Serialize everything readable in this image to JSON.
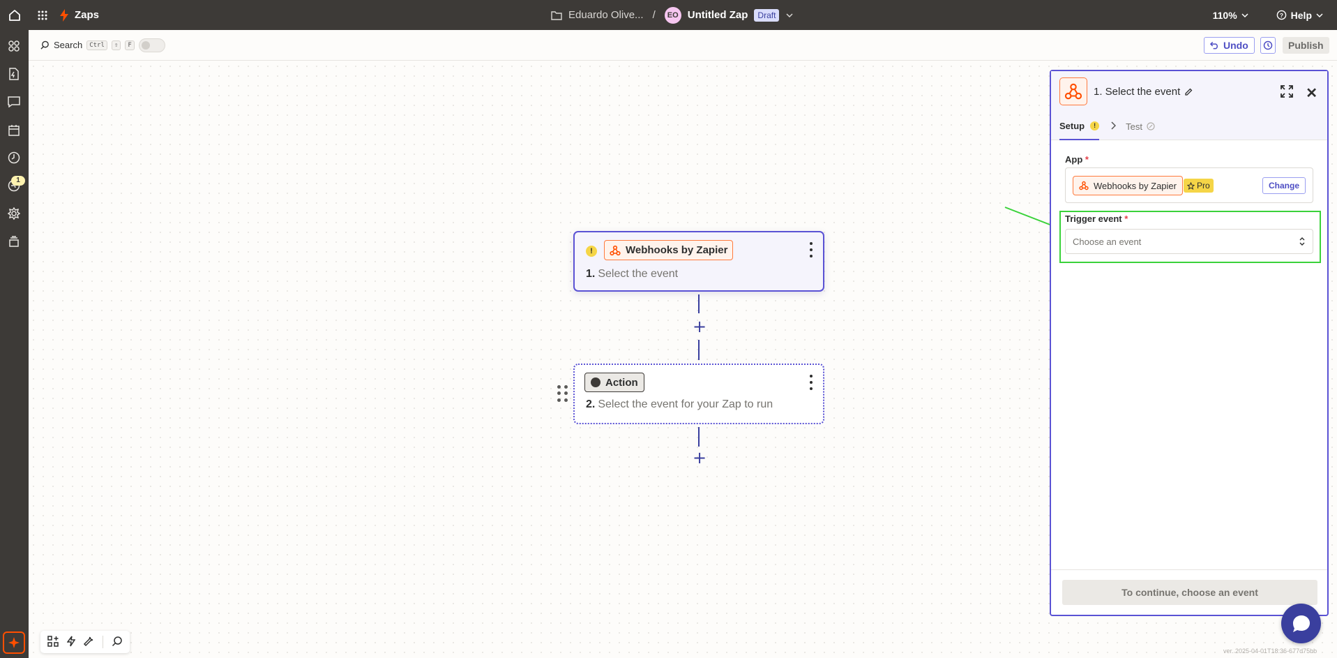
{
  "topbar": {
    "app_name": "Zaps",
    "folder": "Eduardo Olive...",
    "separator": "/",
    "avatar_initials": "EO",
    "zap_name": "Untitled Zap",
    "status": "Draft",
    "zoom": "110%",
    "help": "Help"
  },
  "sidebar": {
    "notification_count": "1",
    "icons": [
      "apps-icon",
      "zap-file-icon",
      "chat-icon",
      "calendar-icon",
      "history-icon",
      "activity-icon",
      "settings-icon",
      "layers-icon"
    ]
  },
  "toolbar": {
    "search_label": "Search",
    "kbd_ctrl": "Ctrl",
    "kbd_shift": "⇧",
    "kbd_f": "F",
    "undo_label": "Undo",
    "publish_label": "Publish"
  },
  "canvas": {
    "trigger": {
      "app": "Webhooks by Zapier",
      "step_number": "1.",
      "step_text": "Select the event"
    },
    "action": {
      "badge": "Action",
      "step_number": "2.",
      "step_text": "Select the event for your Zap to run"
    },
    "add_step": "+"
  },
  "panel": {
    "title": "1. Select the event",
    "tabs": {
      "setup": "Setup",
      "test": "Test"
    },
    "app_label": "App",
    "required_mark": "*",
    "app_value": "Webhooks by Zapier",
    "pro_badge": "Pro",
    "change_label": "Change",
    "trigger_label": "Trigger event",
    "trigger_placeholder": "Choose an event",
    "continue_label": "To continue, choose an event"
  },
  "version": "ver. 2025-04-01T18:36-677d75bb",
  "colors": {
    "accent": "#5a52d4",
    "brand_orange": "#ff4f00",
    "dark": "#3d3a37",
    "highlight_green": "#3ad23a"
  }
}
